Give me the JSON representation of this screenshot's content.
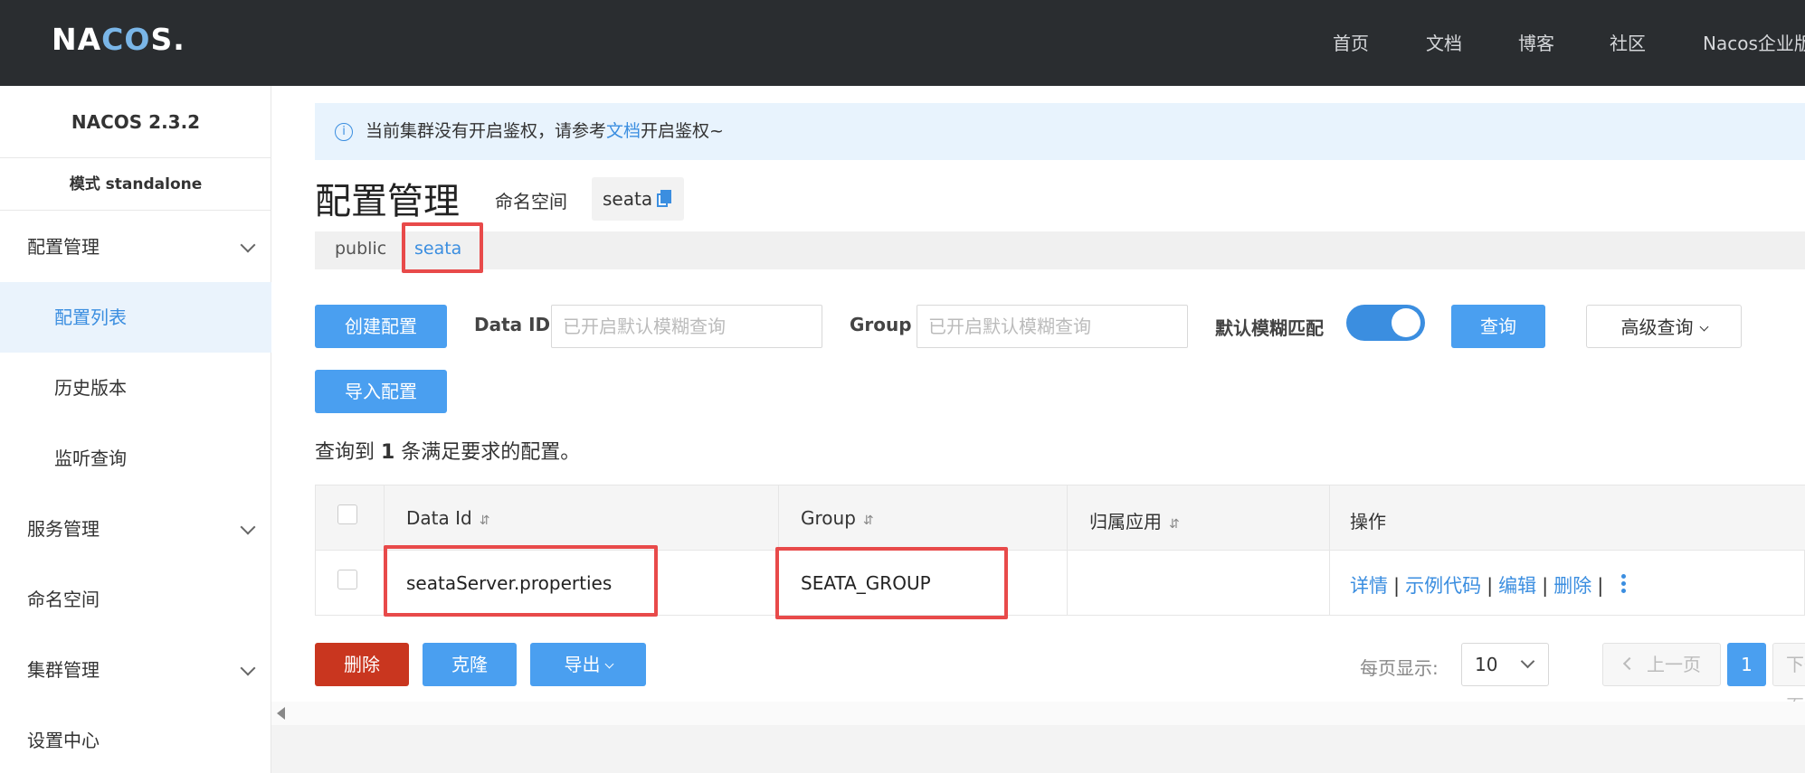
{
  "topbar": {
    "logo": {
      "pre": "NA",
      "co": "CO",
      "post": "S."
    },
    "nav": [
      "首页",
      "文档",
      "博客",
      "社区",
      "Nacos企业版"
    ]
  },
  "sidebar": {
    "version": "NACOS 2.3.2",
    "mode": "模式 standalone",
    "items": [
      {
        "label": "配置管理"
      },
      {
        "label": "配置列表"
      },
      {
        "label": "历史版本"
      },
      {
        "label": "监听查询"
      },
      {
        "label": "服务管理"
      },
      {
        "label": "命名空间"
      },
      {
        "label": "集群管理"
      },
      {
        "label": "设置中心"
      }
    ]
  },
  "notice": {
    "icon": "info-icon",
    "text_before": "当前集群没有开启鉴权，请参考",
    "link": "文档",
    "text_after": "开启鉴权~"
  },
  "header": {
    "title": "配置管理",
    "namespace_label": "命名空间",
    "namespace_value": "seata"
  },
  "namespaces": {
    "public": "public",
    "separator": "|",
    "seata": "seata"
  },
  "toolbar": {
    "create": "创建配置",
    "import": "导入配置",
    "data_id_label": "Data ID",
    "data_id_placeholder": "已开启默认模糊查询",
    "group_label": "Group",
    "group_placeholder": "已开启默认模糊查询",
    "fuzzy_label": "默认模糊匹配",
    "fuzzy_on": true,
    "query": "查询",
    "advanced": "高级查询"
  },
  "result": {
    "prefix": "查询到 ",
    "count": "1",
    "suffix": " 条满足要求的配置。"
  },
  "table": {
    "columns": [
      "Data Id",
      "Group",
      "归属应用",
      "操作"
    ],
    "sort_glyph": "⇵",
    "rows": [
      {
        "data_id": "seataServer.properties",
        "group": "SEATA_GROUP",
        "app": ""
      }
    ],
    "ops": [
      "详情",
      "示例代码",
      "编辑",
      "删除"
    ],
    "op_sep": "|"
  },
  "bottom": {
    "delete": "删除",
    "clone": "克隆",
    "export": "导出",
    "page_size_label": "每页显示:",
    "page_size": "10",
    "prev": "上一页",
    "current_page": "1",
    "next": "下一页"
  },
  "colors": {
    "accent": "#3b8ee0",
    "topbar": "#2a2d30",
    "danger": "#c9361f",
    "highlight": "#e84a4a"
  }
}
